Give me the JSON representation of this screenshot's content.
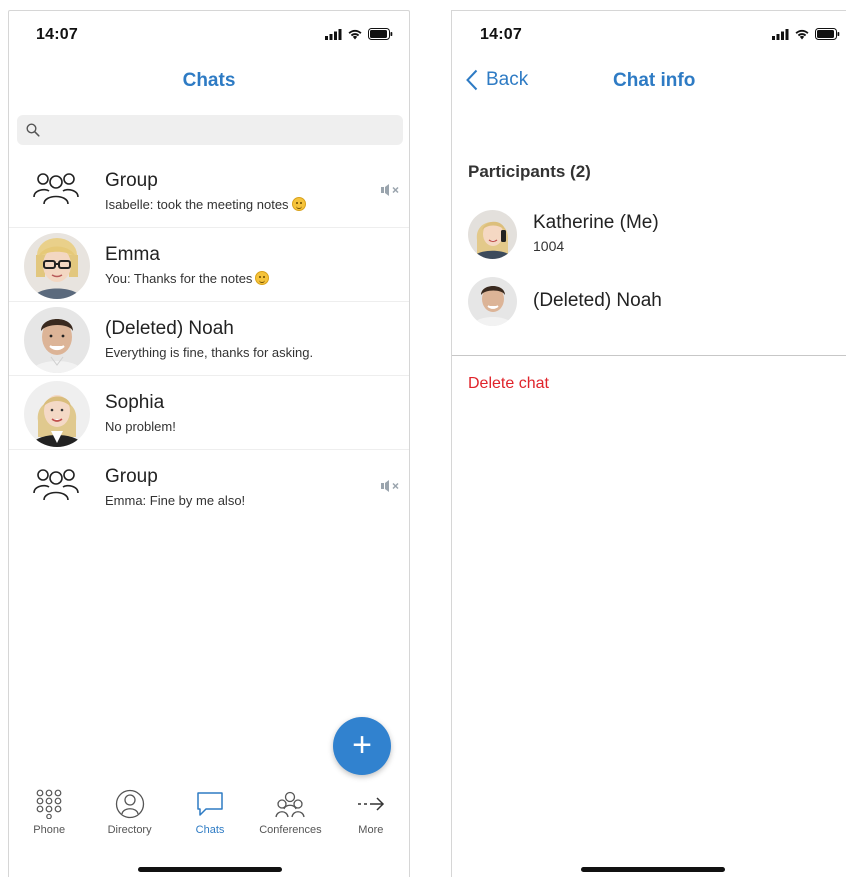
{
  "left_screen": {
    "status": {
      "time": "14:07"
    },
    "title": "Chats",
    "search": {
      "placeholder": ""
    },
    "chats": [
      {
        "name": "Group",
        "preview": "Isabelle: took the meeting notes",
        "avatar": "group-icon",
        "muted": true,
        "emoji": true
      },
      {
        "name": "Emma",
        "preview": "You: Thanks for the notes",
        "avatar": "photo-woman-glasses",
        "muted": false,
        "emoji": true
      },
      {
        "name": "(Deleted) Noah",
        "preview": "Everything is fine, thanks for asking.",
        "avatar": "photo-man",
        "muted": false,
        "emoji": false
      },
      {
        "name": "Sophia",
        "preview": "No problem!",
        "avatar": "photo-woman-blonde",
        "muted": false,
        "emoji": false
      },
      {
        "name": "Group",
        "preview": "Emma: Fine by me also!",
        "avatar": "group-icon",
        "muted": true,
        "emoji": false
      }
    ],
    "fab_label": "+",
    "tabs": [
      {
        "label": "Phone",
        "icon": "dialpad-icon",
        "active": false
      },
      {
        "label": "Directory",
        "icon": "person-circle-icon",
        "active": false
      },
      {
        "label": "Chats",
        "icon": "chat-bubble-icon",
        "active": true
      },
      {
        "label": "Conferences",
        "icon": "people-icon",
        "active": false
      },
      {
        "label": "More",
        "icon": "arrow-right-icon",
        "active": false
      }
    ]
  },
  "right_screen": {
    "status": {
      "time": "14:07"
    },
    "back_label": "Back",
    "title": "Chat info",
    "participants_header": "Participants (2)",
    "participants": [
      {
        "name": "Katherine (Me)",
        "extension": "1004",
        "avatar": "photo-woman-phone"
      },
      {
        "name": "(Deleted) Noah",
        "extension": "",
        "avatar": "photo-man"
      }
    ],
    "delete_label": "Delete chat"
  },
  "colors": {
    "accent": "#2e7bc4",
    "fab": "#3182cf",
    "danger": "#e0242b",
    "search_bg": "#efefef"
  }
}
